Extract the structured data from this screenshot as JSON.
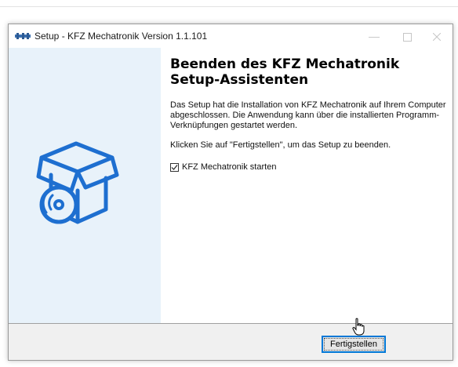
{
  "window": {
    "title": "Setup - KFZ Mechatronik Version 1.1.101",
    "controls": {
      "minimize": "—"
    }
  },
  "content": {
    "heading": "Beenden des KFZ Mechatronik Setup-Assistenten",
    "paragraph_1": "Das Setup hat die Installation von KFZ Mechatronik auf Ihrem Computer abgeschlossen. Die Anwendung kann über die installierten Programm-Verknüpfungen gestartet werden.",
    "paragraph_2": "Klicken Sie auf \"Fertigstellen\", um das Setup zu beenden.",
    "checkbox": {
      "label": "KFZ Mechatronik starten",
      "checked": true
    }
  },
  "footer": {
    "finish_label": "Fertigstellen"
  },
  "colors": {
    "accent": "#0078d7",
    "sidebar": "#e8f2fa",
    "illustration": "#1e6fd0"
  },
  "icons": [
    "setup-app-icon",
    "box-with-disc-icon",
    "checkmark-icon",
    "mouse-cursor-icon"
  ]
}
